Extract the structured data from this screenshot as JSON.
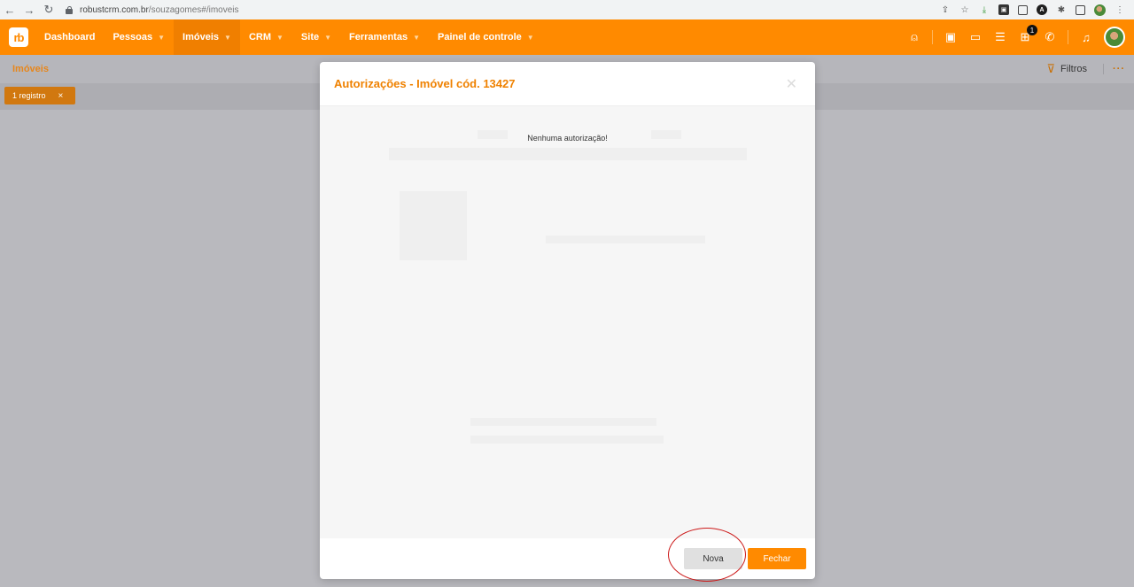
{
  "browser": {
    "url_host": "robustcrm.com.br",
    "url_path": "/souzagomes#/imoveis"
  },
  "header": {
    "logo": "rb",
    "menu": [
      {
        "label": "Dashboard"
      },
      {
        "label": "Pessoas"
      },
      {
        "label": "Imóveis"
      },
      {
        "label": "CRM"
      },
      {
        "label": "Site"
      },
      {
        "label": "Ferramentas"
      },
      {
        "label": "Painel de controle"
      }
    ],
    "notification_count": "1"
  },
  "subheader": {
    "breadcrumb": "Imóveis",
    "filters_label": "Filtros",
    "more_label": "···"
  },
  "filter_chip": {
    "label": "1 registro",
    "close": "×"
  },
  "modal": {
    "title": "Autorizações - Imóvel cód. 13427",
    "empty_message": "Nenhuma autorização!",
    "nova_label": "Nova",
    "fechar_label": "Fechar"
  },
  "colors": {
    "brand_orange": "#ff8a00",
    "highlight_red": "#cc1a1a"
  }
}
